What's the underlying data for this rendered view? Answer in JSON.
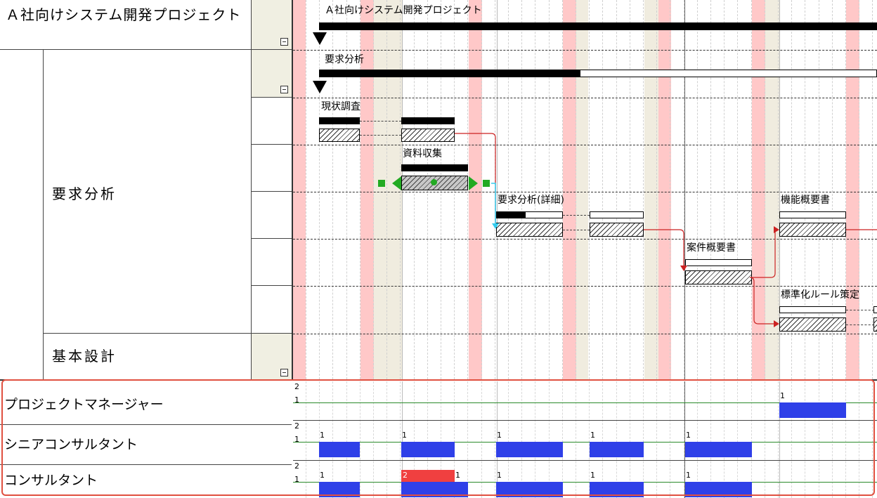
{
  "colors": {
    "weekend": "#ffc8c8",
    "holiday_band": "#f0ecdf",
    "left_panel_bg": "#f0efe2",
    "resource_bar": "#2f40e8",
    "over_allocation": "#f04040",
    "dependency_arrow": "#cc2222",
    "resource_frame": "#e05040"
  },
  "wbs": {
    "project_label": "Ａ社向けシステム開発プロジェクト",
    "phase_requirements": "要求分析",
    "phase_design": "基本設計"
  },
  "tasks": {
    "project": "Ａ社向けシステム開発プロジェクト",
    "requirements": "要求分析",
    "current_survey": "現状調査",
    "data_collection": "資料収集",
    "req_detail": "要求分析(詳細)",
    "case_summary": "案件概要書",
    "function_summary": "機能概要書",
    "standardization": "標準化ルール策定"
  },
  "resources": [
    {
      "name": "プロジェクトマネージャー"
    },
    {
      "name": "シニアコンサルタント"
    },
    {
      "name": "コンサルタント"
    }
  ],
  "axis": {
    "tick_2": "2",
    "tick_1": "1"
  },
  "allocation_labels": {
    "one": "1",
    "two": "2"
  }
}
